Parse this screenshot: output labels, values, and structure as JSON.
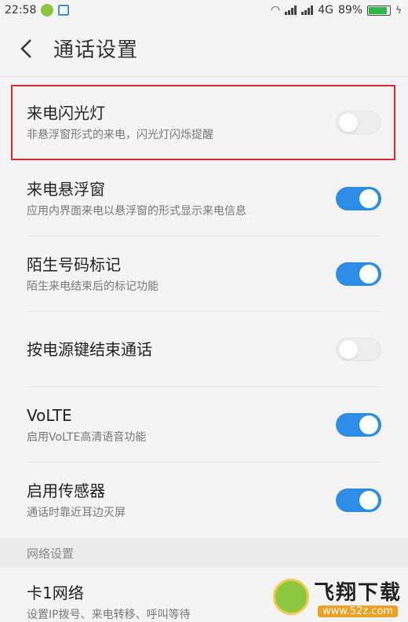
{
  "status_bar": {
    "time": "22:58",
    "network": "4G",
    "battery": "89%"
  },
  "header": {
    "title": "通话设置"
  },
  "settings": [
    {
      "title": "来电闪光灯",
      "subtitle": "非悬浮窗形式的来电，闪光灯闪烁提醒",
      "on": false
    },
    {
      "title": "来电悬浮窗",
      "subtitle": "应用内界面来电以悬浮窗的形式显示来电信息",
      "on": true
    },
    {
      "title": "陌生号码标记",
      "subtitle": "陌生来电结束后的标记功能",
      "on": true
    },
    {
      "title": "按电源键结束通话",
      "subtitle": "",
      "on": false
    },
    {
      "title": "VoLTE",
      "subtitle": "启用VoLTE高清语音功能",
      "on": true
    },
    {
      "title": "启用传感器",
      "subtitle": "通话时靠近耳边灭屏",
      "on": true
    }
  ],
  "section": {
    "label": "网络设置"
  },
  "network_item": {
    "title": "卡1网络",
    "subtitle": "设置IP拨号、来电转移、呼叫等待"
  },
  "watermark": {
    "name": "飞翔下载",
    "url": "www.52z.com"
  },
  "colors": {
    "toggle_on": "#2c8ce6",
    "highlight": "#e0282e"
  }
}
